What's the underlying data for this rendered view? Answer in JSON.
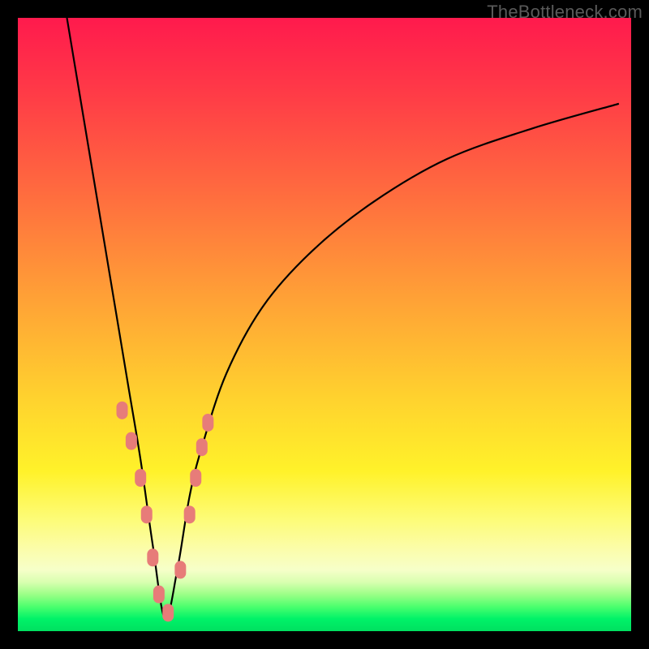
{
  "watermark": "TheBottleneck.com",
  "colors": {
    "frame": "#000000",
    "curve": "#000000",
    "marker_fill": "#e77c79",
    "marker_stroke": "#b65a57"
  },
  "chart_data": {
    "type": "line",
    "title": "",
    "xlabel": "",
    "ylabel": "",
    "xlim": [
      0,
      100
    ],
    "ylim": [
      0,
      100
    ],
    "note": "Axes are unlabeled; values are pixel-fraction estimates (0–100) read directly from the figure. Minimum of V-curve sits near x≈24, y≈2.",
    "series": [
      {
        "name": "bottleneck-curve",
        "x": [
          8,
          10,
          12,
          14,
          16,
          18,
          20,
          22,
          24,
          26,
          28,
          30,
          34,
          40,
          48,
          58,
          70,
          84,
          98
        ],
        "y": [
          100,
          88,
          76,
          64,
          52,
          40,
          28,
          14,
          2,
          10,
          22,
          30,
          42,
          53,
          62,
          70,
          77,
          82,
          86
        ]
      }
    ],
    "markers": {
      "name": "highlighted-points",
      "x": [
        17,
        18.5,
        20,
        21,
        22,
        23,
        24.5,
        26.5,
        28,
        29,
        30,
        31
      ],
      "y": [
        36,
        31,
        25,
        19,
        12,
        6,
        3,
        10,
        19,
        25,
        30,
        34
      ]
    }
  }
}
